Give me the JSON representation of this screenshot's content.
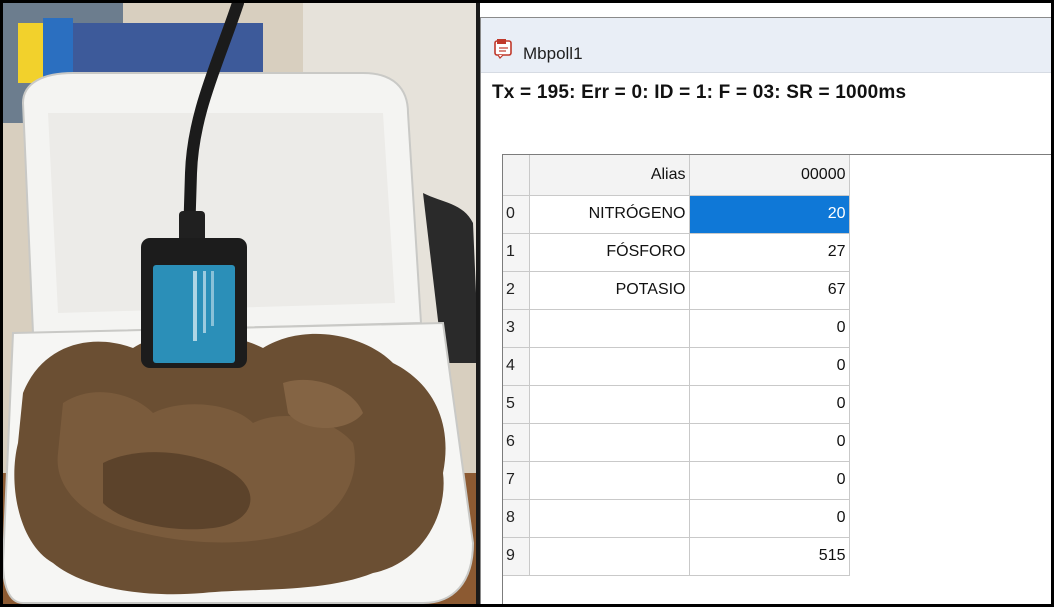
{
  "window": {
    "title": "Mbpoll1",
    "status": "Tx = 195: Err = 0: ID = 1: F = 03: SR = 1000ms"
  },
  "grid": {
    "header": {
      "alias": "Alias",
      "column": "00000"
    },
    "rows": [
      {
        "index": "0",
        "alias": "NITRÓGENO",
        "value": "20"
      },
      {
        "index": "1",
        "alias": "FÓSFORO",
        "value": "27"
      },
      {
        "index": "2",
        "alias": "POTASIO",
        "value": "67"
      },
      {
        "index": "3",
        "alias": "",
        "value": "0"
      },
      {
        "index": "4",
        "alias": "",
        "value": "0"
      },
      {
        "index": "5",
        "alias": "",
        "value": "0"
      },
      {
        "index": "6",
        "alias": "",
        "value": "0"
      },
      {
        "index": "7",
        "alias": "",
        "value": "0"
      },
      {
        "index": "8",
        "alias": "",
        "value": "0"
      },
      {
        "index": "9",
        "alias": "",
        "value": "515"
      }
    ],
    "selected_row": "0"
  },
  "colors": {
    "selection": "#0f78d7",
    "titlebar": "#e9eef6"
  },
  "icons": {
    "app": "mbpoll-app-icon"
  }
}
